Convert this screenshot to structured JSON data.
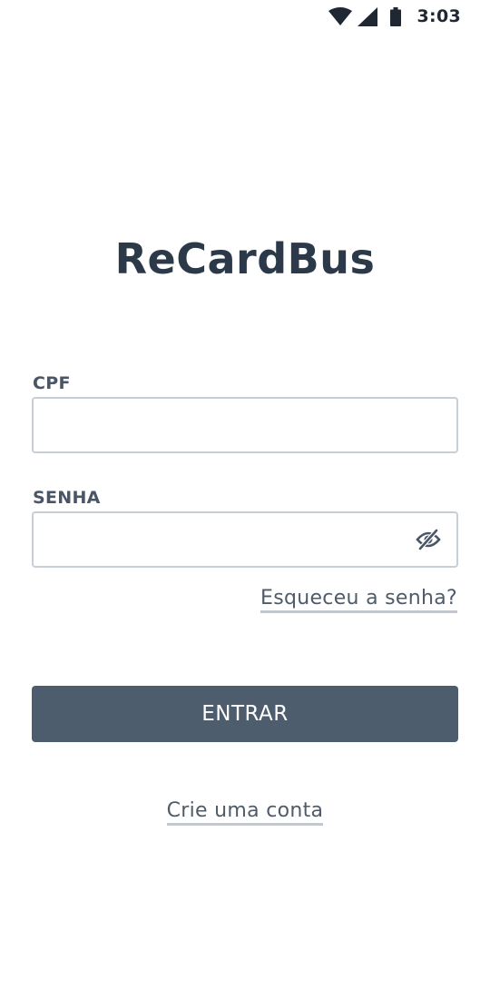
{
  "status_bar": {
    "time": "3:03",
    "icons": [
      "wifi-icon",
      "cell-signal-icon",
      "battery-icon"
    ]
  },
  "app": {
    "title": "ReCardBus"
  },
  "form": {
    "cpf": {
      "label": "CPF",
      "value": "",
      "placeholder": ""
    },
    "senha": {
      "label": "SENHA",
      "value": "",
      "placeholder": "",
      "visibility_icon": "eye-off-icon"
    },
    "forgot_password_label": "Esqueceu a senha?",
    "submit_label": "ENTRAR",
    "create_account_label": "Crie uma conta"
  },
  "colors": {
    "title": "#2b3949",
    "label": "#4a5666",
    "input_border": "#c7ced6",
    "button_bg": "#4d5d6d",
    "button_text": "#ffffff",
    "link_text": "#4f5b69",
    "link_underline": "#c3c8ce"
  }
}
